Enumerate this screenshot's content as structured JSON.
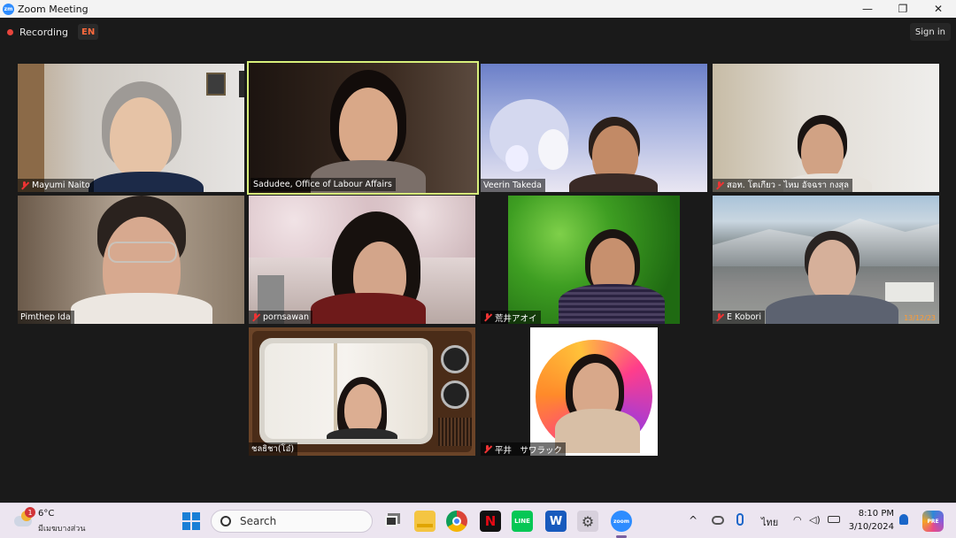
{
  "window": {
    "title": "Zoom Meeting",
    "minimize": "—",
    "restore": "❐",
    "close": "✕",
    "logo": "zm"
  },
  "topbar": {
    "recording_label": "Recording",
    "language": "EN",
    "sign_in": "Sign in"
  },
  "participants": [
    {
      "name": "Mayumi Naito",
      "muted": true
    },
    {
      "name": "Sadudee, Office of Labour Affairs",
      "muted": false,
      "speaking": true
    },
    {
      "name": "Veerin Takeda",
      "muted": false
    },
    {
      "name": "สอท. โตเกียว - ไหม อัจฉรา กงสุล",
      "muted": true
    },
    {
      "name": "Pimthep Ida",
      "muted": false
    },
    {
      "name": "pornsawan",
      "muted": true
    },
    {
      "name": "荒井アオイ",
      "muted": true
    },
    {
      "name": "E Kobori",
      "muted": true
    },
    {
      "name": "ชลธิชา(โอ๋)",
      "muted": false
    },
    {
      "name": "平井　サワラック",
      "muted": true
    }
  ],
  "video_timestamp": "13/12/23",
  "taskbar": {
    "weather": {
      "temp": "6°C",
      "desc": "มีเมฆบางส่วน",
      "badge": "1"
    },
    "search_placeholder": "Search",
    "pinned": [
      "windows-start",
      "task-view",
      "file-explorer",
      "chrome",
      "netflix",
      "line",
      "word",
      "settings",
      "zoom"
    ],
    "input_language": "ไทย",
    "time": "8:10 PM",
    "date": "3/10/2024",
    "line_label": "LINE",
    "word_label": "W",
    "zoom_label": "zoom",
    "netflix_label": "N",
    "copilot_label": "PRE"
  }
}
